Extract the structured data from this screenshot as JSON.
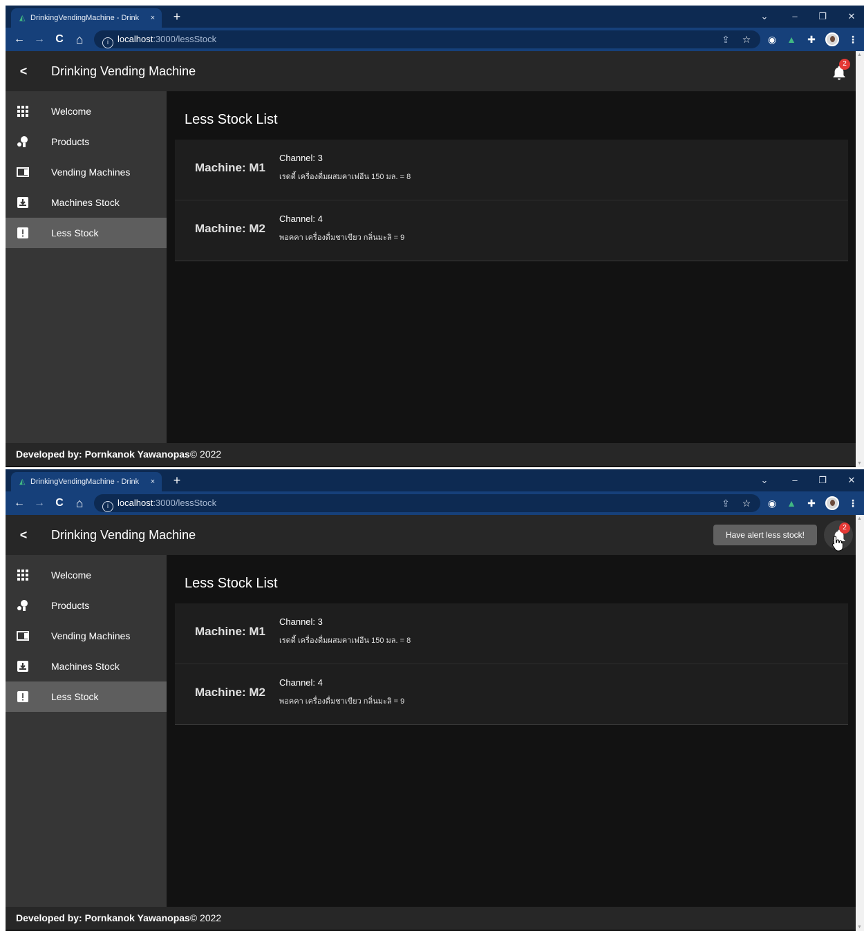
{
  "browser": {
    "tab_title": "DrinkingVendingMachine - Drink",
    "tab_close": "×",
    "new_tab": "+",
    "url_host": "localhost",
    "url_path": ":3000/lessStock",
    "info_glyph": "i",
    "window_controls": [
      "⌄",
      "–",
      "❐",
      "✕"
    ],
    "nav_glyphs": {
      "back": "←",
      "forward": "→",
      "reload": "C",
      "home": "⌂"
    },
    "toolbar_icons": [
      "share-icon",
      "star-icon",
      "camera-icon",
      "vue-icon",
      "extensions-icon",
      "profile-avatar",
      "menu-icon"
    ]
  },
  "app": {
    "back_glyph": "<",
    "title": "Drinking Vending Machine",
    "notification_count": "2",
    "tooltip": "Have alert less stock!"
  },
  "sidebar": {
    "items": [
      {
        "label": "Welcome",
        "icon": "grid-icon",
        "active": false
      },
      {
        "label": "Products",
        "icon": "products-icon",
        "active": false
      },
      {
        "label": "Vending Machines",
        "icon": "vending-machine-icon",
        "active": false
      },
      {
        "label": "Machines Stock",
        "icon": "inbox-icon",
        "active": false
      },
      {
        "label": "Less Stock",
        "icon": "alert-icon",
        "active": true
      }
    ]
  },
  "main": {
    "title": "Less Stock List",
    "rows": [
      {
        "machine": "Machine: M1",
        "channel": "Channel: 3",
        "product": "เรดดี้ เครื่องดื่มผสมคาเฟอีน 150 มล. = 8"
      },
      {
        "machine": "Machine: M2",
        "channel": "Channel: 4",
        "product": "พอคคา เครื่องดื่มชาเขียว กลิ่นมะลิ = 9"
      }
    ]
  },
  "footer": {
    "label": "Developed by: Pornkanok Yawanopas",
    "suffix": "© 2022"
  },
  "colors": {
    "tabstrip": "#0d2a52",
    "toolbar": "#16407a",
    "appbar": "#272727",
    "sidebar": "#363636",
    "sidebar_active": "#5e5e5e",
    "main_bg": "#121212",
    "card_bg": "#1e1e1e",
    "badge": "#e53935"
  }
}
